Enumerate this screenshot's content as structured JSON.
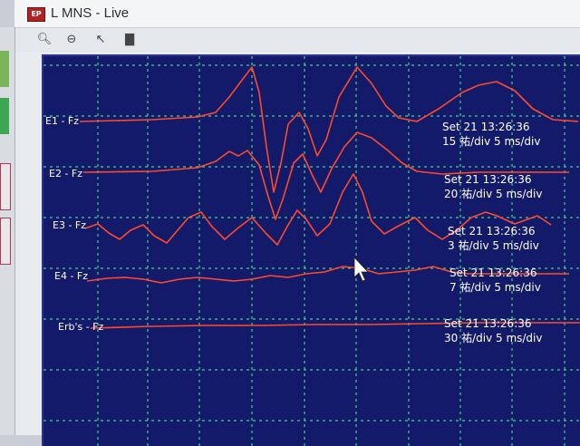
{
  "window": {
    "title": "L MNS - Live",
    "icon": "EP"
  },
  "toolbar": {
    "icons": [
      "zoom-in-icon",
      "zoom-out-icon",
      "cursor-icon",
      "chart-icon"
    ]
  },
  "channels": [
    {
      "label": "E1 - Fz",
      "timestamp": "Set 21 13:26:36",
      "scale": "15 祐/div 5 ms/div"
    },
    {
      "label": "E2 - Fz",
      "timestamp": "Set 21 13:26:36",
      "scale": "20 祐/div 5 ms/div"
    },
    {
      "label": "E3 - Fz",
      "timestamp": "Set 21 13:26:36",
      "scale": "3 祐/div 5 ms/div"
    },
    {
      "label": "E4 - Fz",
      "timestamp": "Set 21 13:26:36",
      "scale": "7 祐/div 5 ms/div"
    },
    {
      "label": "Erb's - Fz",
      "timestamp": "Set 21 13:26:36",
      "scale": "30 祐/div 5 ms/div"
    }
  ],
  "colors": {
    "background": "#141a6a",
    "grid": "#3fd08a",
    "trace": "#ff4a2a",
    "text": "#ffffff"
  }
}
